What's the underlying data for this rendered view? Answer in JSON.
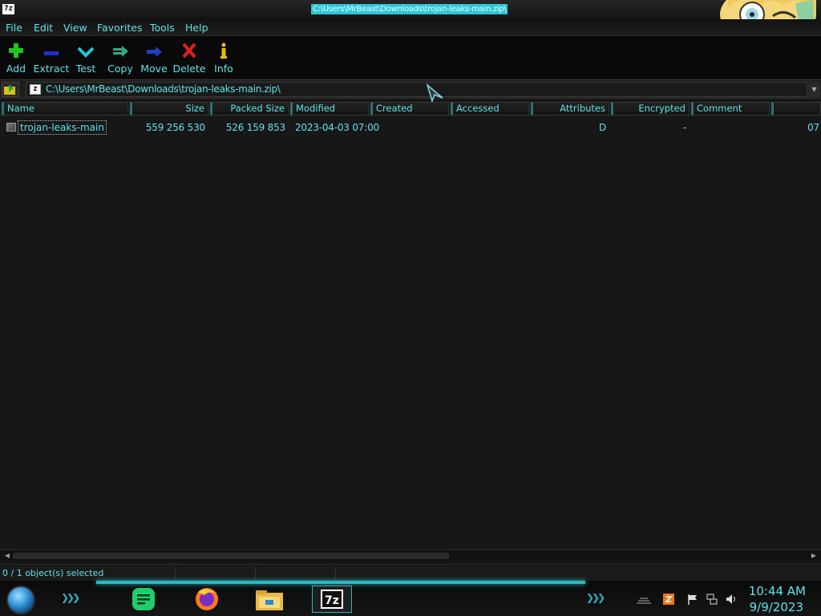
{
  "window": {
    "title": "C:\\Users\\MrBeast\\Downloads\\trojan-leaks-main.zip\\",
    "app_icon_text": "7z"
  },
  "menu": [
    "File",
    "Edit",
    "View",
    "Favorites",
    "Tools",
    "Help"
  ],
  "toolbar": [
    {
      "label": "Add",
      "icon": "plus-icon",
      "color": "#22c422"
    },
    {
      "label": "Extract",
      "icon": "minus-icon",
      "color": "#1a2fd6"
    },
    {
      "label": "Test",
      "icon": "check-icon",
      "color": "#27c4d9"
    },
    {
      "label": "Copy",
      "icon": "copy-arrow-icon",
      "color": "#3aa58a"
    },
    {
      "label": "Move",
      "icon": "move-arrow-icon",
      "color": "#2040c0"
    },
    {
      "label": "Delete",
      "icon": "x-icon",
      "color": "#e02020"
    },
    {
      "label": "Info",
      "icon": "info-icon",
      "color": "#e8c000"
    }
  ],
  "address": {
    "path": "C:\\Users\\MrBeast\\Downloads\\trojan-leaks-main.zip\\"
  },
  "columns": [
    "Name",
    "Size",
    "Packed Size",
    "Modified",
    "Created",
    "Accessed",
    "Attributes",
    "Encrypted",
    "Comment"
  ],
  "rows": [
    {
      "name": "trojan-leaks-main",
      "size": "559 256 530",
      "packed_size": "526 159 853",
      "modified": "2023-04-03 07:00",
      "created": "",
      "accessed": "",
      "attributes": "D",
      "encrypted": "-",
      "comment": "",
      "overflow": "07"
    }
  ],
  "status": {
    "selection": "0 / 1 object(s) selected"
  },
  "taskbar": {
    "apps": [
      "notes-app-icon",
      "firefox-icon",
      "file-explorer-icon",
      "7zip-icon"
    ],
    "active_app_label": "7z",
    "time": "10:44 AM",
    "date": "9/9/2023"
  },
  "colors": {
    "text_accent": "#5fe3e8",
    "background": "#161616",
    "title_highlight": "#2ec6d4"
  }
}
